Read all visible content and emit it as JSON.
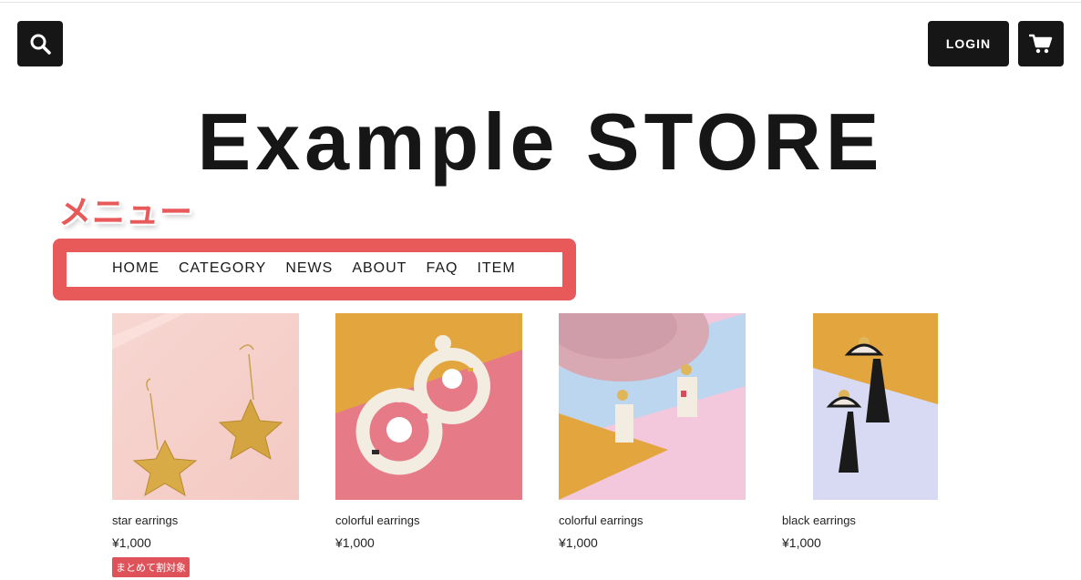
{
  "header": {
    "login_label": "LOGIN",
    "search_icon": "search-icon",
    "cart_icon": "cart-icon"
  },
  "store": {
    "title": "Example STORE"
  },
  "annotation": {
    "label": "メニュー",
    "color": "#e85a5a"
  },
  "nav": {
    "items": [
      {
        "label": "HOME"
      },
      {
        "label": "CATEGORY"
      },
      {
        "label": "NEWS"
      },
      {
        "label": "ABOUT"
      },
      {
        "label": "FAQ"
      },
      {
        "label": "ITEM"
      }
    ]
  },
  "products": [
    {
      "name": "star earrings",
      "price": "¥1,000",
      "badge": "まとめて割対象"
    },
    {
      "name": "colorful earrings",
      "price": "¥1,000"
    },
    {
      "name": "colorful earrings",
      "price": "¥1,000"
    },
    {
      "name": "black earrings",
      "price": "¥1,000"
    }
  ],
  "colors": {
    "button_bg": "#161616",
    "accent": "#e85a5a",
    "badge": "#e0525a"
  }
}
